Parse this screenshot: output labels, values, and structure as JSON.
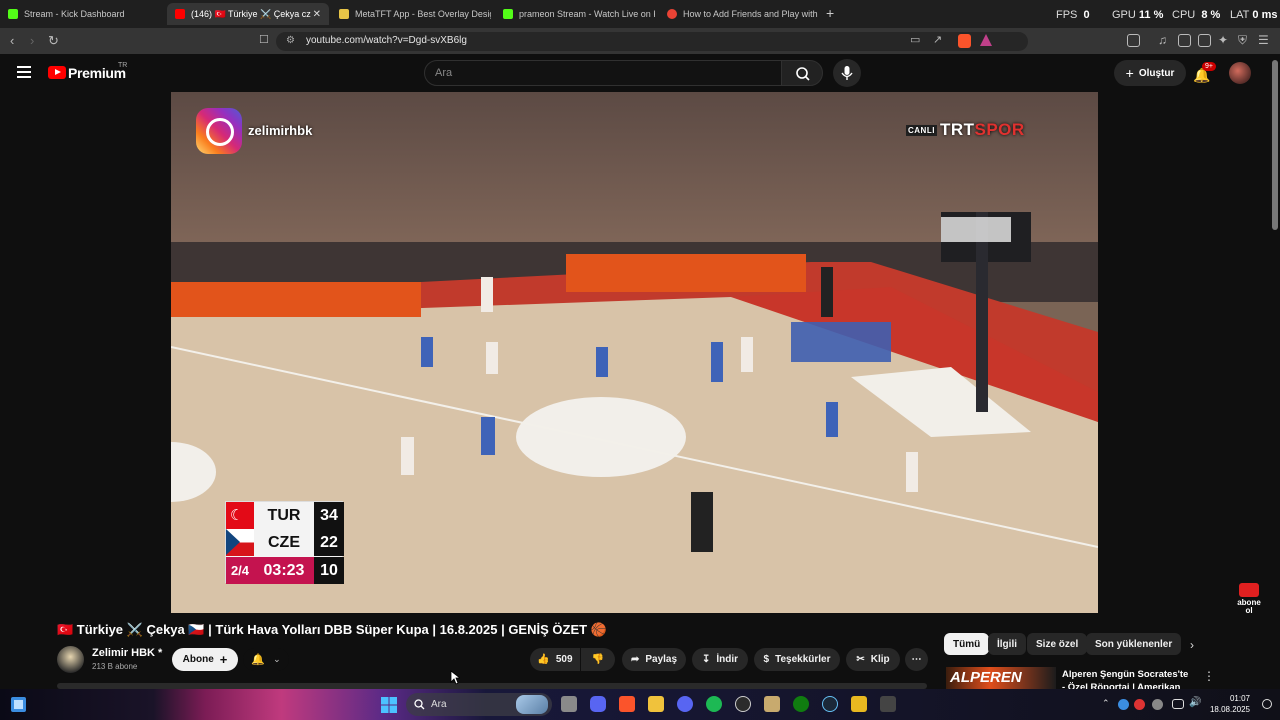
{
  "browser": {
    "tabs": [
      {
        "title": "Stream - Kick Dashboard",
        "active": false,
        "favicon_color": "#53fc18"
      },
      {
        "title": "(146) 🇹🇷 Türkiye ⚔️ Çekya cz",
        "active": true,
        "favicon_color": "#ff0000"
      },
      {
        "title": "MetaTFT App - Best Overlay Designe",
        "active": false,
        "favicon_color": "#e8c547"
      },
      {
        "title": "prameon Stream - Watch Live on Kick",
        "active": false,
        "favicon_color": "#53fc18"
      },
      {
        "title": "How to Add Friends and Play with Ot",
        "active": false,
        "favicon_color": "#ea4335"
      }
    ],
    "new_tab_label": "+",
    "stats": {
      "fps_label": "FPS",
      "fps_value": "0",
      "gpu_label": "GPU",
      "gpu_value": "11 %",
      "cpu_label": "CPU",
      "cpu_value": "8 %",
      "lat_label": "LAT",
      "lat_value": "0 ms"
    },
    "url": "youtube.com/watch?v=Dgd-svXB6lg"
  },
  "youtube": {
    "brand": "Premium",
    "region": "TR",
    "search_placeholder": "Ara",
    "create_label": "Oluştur",
    "notification_badge": "9+"
  },
  "video": {
    "watermark_user": "zelimirhbk",
    "broadcaster_live": "CANLI",
    "broadcaster_main": "TRT",
    "broadcaster_sub": "SPOR",
    "scoreboard": {
      "home_team": "TUR",
      "home_score": "34",
      "away_team": "CZE",
      "away_score": "22",
      "period": "2/4",
      "clock": "03:23",
      "shot_clock": "10"
    },
    "subscribe_overlay": "abone ol"
  },
  "watch": {
    "title": "🇹🇷 Türkiye ⚔️ Çekya 🇨🇿 | Türk Hava Yolları DBB Süper Kupa | 16.8.2025 | GENİŞ ÖZET 🏀",
    "channel_name": "Zelimir HBK *",
    "channel_subs": "213 B abone",
    "subscribe_label": "Abone",
    "like_count": "509",
    "share_label": "Paylaş",
    "download_label": "İndir",
    "thanks_label": "Teşekkürler",
    "clip_label": "Klip",
    "more_label": "⋯"
  },
  "chips": [
    "Tümü",
    "İlgili",
    "Size özel",
    "Son yüklenenler"
  ],
  "recommendation": {
    "thumb_text": "ALPEREN",
    "title": "Alperen Şengün Socrates'te - Özel Röportaj | Amerikan"
  },
  "taskbar": {
    "search_placeholder": "Ara",
    "time": "01:07",
    "date": "18.08.2025"
  }
}
